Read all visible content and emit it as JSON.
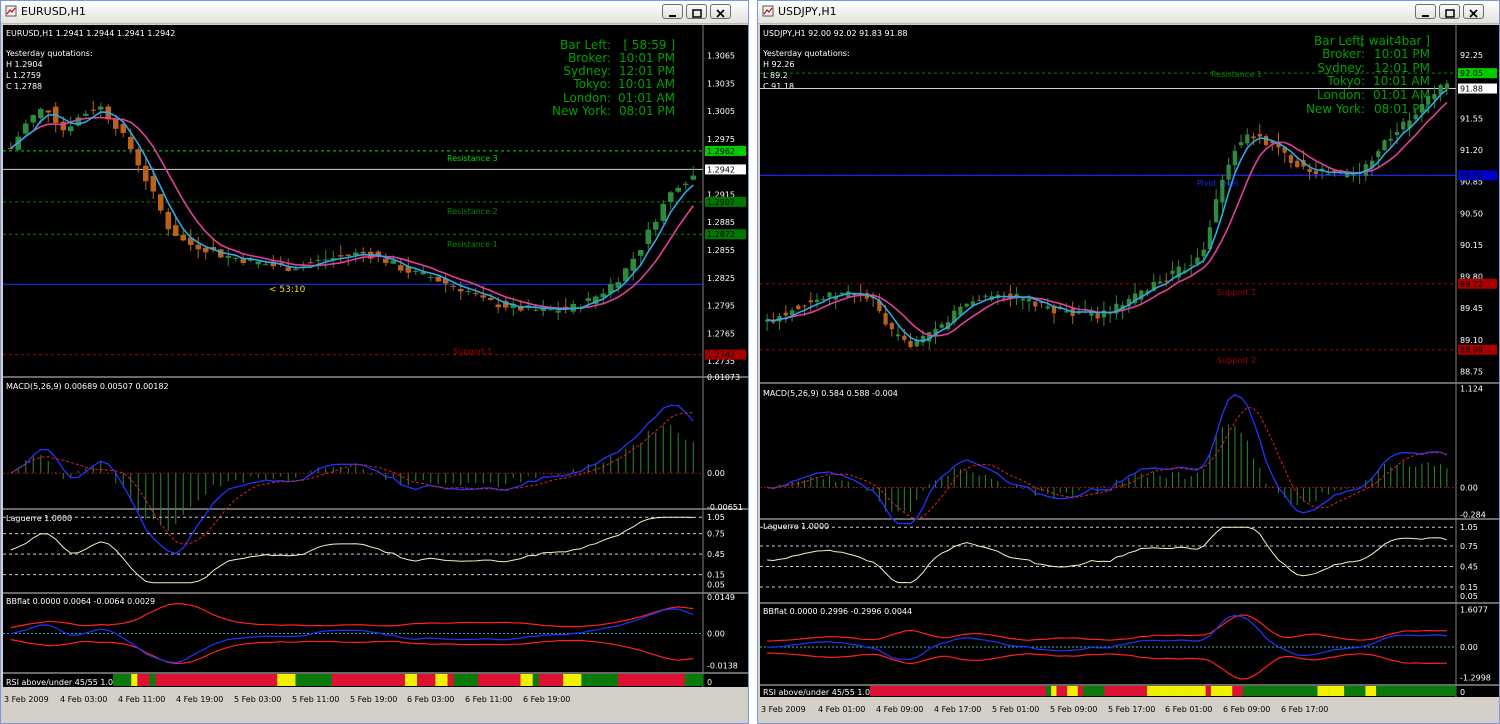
{
  "windows": [
    {
      "title": "EURUSD,H1",
      "header": "EURUSD,H1  1.2941 1.2944 1.2941 1.2942",
      "yesterday": {
        "title": "Yesterday quotations:",
        "h": "H 1.2904",
        "l": "L 1.2759",
        "c": "C 1.2788"
      },
      "info": [
        {
          "label": "Bar Left:",
          "value": "[ 58:59 ]"
        },
        {
          "label": "Broker:",
          "value": "10:01 PM"
        },
        {
          "label": "Sydney:",
          "value": "12:01 PM"
        },
        {
          "label": "Tokyo:",
          "value": "10:01 AM"
        },
        {
          "label": "London:",
          "value": "01:01 AM"
        },
        {
          "label": "New York:",
          "value": "08:01 PM"
        }
      ],
      "countdown": "< 53:10",
      "price_axis": [
        "1.3065",
        "1.3035",
        "1.3005",
        "1.2975",
        "1.2942",
        "1.2915",
        "1.2885",
        "1.2855",
        "1.2825",
        "1.2795",
        "1.2765",
        "1.2735"
      ],
      "levels": [
        {
          "label": "Resistance 3",
          "color": "#00dd00"
        },
        {
          "label": "Resistance 2",
          "color": "#008800"
        },
        {
          "label": "Resistance 1",
          "color": "#008800"
        },
        {
          "label": "Support 1",
          "color": "#aa0000"
        }
      ],
      "macd": {
        "label": "MACD(5,26,9) 0.00689 0.00507 0.00182",
        "axis": [
          "0.01073",
          "0.00",
          "-0.00651"
        ]
      },
      "laguerre": {
        "label": "Laguerre 1.0000",
        "axis": [
          "1.05",
          "0.75",
          "0.45",
          "0.15",
          "0.05"
        ]
      },
      "bbflat": {
        "label": "BBflat 0.0000 0.0064 -0.0064 0.0029",
        "axis": [
          "0.0149",
          "0.00",
          "-0.0138"
        ]
      },
      "rsi": {
        "label": "RSI above/under 45/55 1.0000"
      },
      "time_axis": [
        "3 Feb 2009",
        "4 Feb 03:00",
        "4 Feb 11:00",
        "4 Feb 19:00",
        "5 Feb 03:00",
        "5 Feb 11:00",
        "5 Feb 19:00",
        "6 Feb 03:00",
        "6 Feb 11:00",
        "6 Feb 19:00"
      ],
      "chart_data": {
        "type": "line",
        "series": [
          {
            "values": [
              1.2965,
              1.2995,
              1.301,
              1.2985,
              1.3,
              1.3012,
              1.299,
              1.296,
              1.292,
              1.288,
              1.2862,
              1.2858,
              1.285,
              1.2846,
              1.2842,
              1.2838,
              1.2836,
              1.284,
              1.2845,
              1.2848,
              1.2852,
              1.2848,
              1.2838,
              1.283,
              1.2826,
              1.2818,
              1.2812,
              1.28,
              1.2796,
              1.2792,
              1.279,
              1.279,
              1.2792,
              1.28,
              1.2812,
              1.283,
              1.2858,
              1.2895,
              1.2925,
              1.2935
            ]
          }
        ]
      }
    },
    {
      "title": "USDJPY,H1",
      "header": "USDJPY,H1  92.00 92.02 91.83 91.88",
      "yesterday": {
        "title": "Yesterday quotations:",
        "h": "H 92.26",
        "l": "L 89.2",
        "c": "C 91.18"
      },
      "info": [
        {
          "label": "Bar Left:",
          "value": "[ wait4bar ]"
        },
        {
          "label": "Broker:",
          "value": "10:01 PM"
        },
        {
          "label": "Sydney:",
          "value": "12:01 PM"
        },
        {
          "label": "Tokyo:",
          "value": "10:01 AM"
        },
        {
          "label": "London:",
          "value": "01:01 AM"
        },
        {
          "label": "New York:",
          "value": "08:01 PM"
        }
      ],
      "price_axis": [
        "92.25",
        "92.05",
        "91.88",
        "91.55",
        "91.20",
        "90.85",
        "90.50",
        "90.15",
        "89.80",
        "89.45",
        "89.10",
        "88.75"
      ],
      "levels": [
        {
          "label": "Resistance 1",
          "color": "#008800"
        },
        {
          "label": "Pivot level",
          "color": "#2222ff"
        },
        {
          "label": "Support 1",
          "color": "#aa0000"
        },
        {
          "label": "Support 2",
          "color": "#aa0000"
        }
      ],
      "macd": {
        "label": "MACD(5,26,9) 0.584 0.588 -0.004",
        "axis": [
          "1.124",
          "0.00",
          "-0.284"
        ]
      },
      "laguerre": {
        "label": "Laguerre 1.0000",
        "axis": [
          "1.05",
          "0.75",
          "0.45",
          "0.15",
          "0.05"
        ]
      },
      "bbflat": {
        "label": "BBflat 0.0000 0.2996 -0.2996 0.0044",
        "axis": [
          "1.6077",
          "0.00",
          "-1.2998"
        ]
      },
      "rsi": {
        "label": "RSI above/under 45/55 1.0000"
      },
      "time_axis": [
        "3 Feb 2009",
        "4 Feb 01:00",
        "4 Feb 09:00",
        "4 Feb 17:00",
        "5 Feb 01:00",
        "5 Feb 09:00",
        "5 Feb 17:00",
        "6 Feb 01:00",
        "6 Feb 09:00",
        "6 Feb 17:00"
      ],
      "chart_data": {
        "type": "line",
        "series": [
          {
            "values": [
              89.3,
              89.4,
              89.5,
              89.55,
              89.6,
              89.62,
              89.55,
              89.2,
              89.05,
              89.1,
              89.25,
              89.45,
              89.55,
              89.6,
              89.58,
              89.52,
              89.45,
              89.42,
              89.4,
              89.38,
              89.45,
              89.55,
              89.7,
              89.8,
              89.9,
              90.1,
              90.8,
              91.3,
              91.35,
              91.25,
              91.1,
              91.0,
              90.95,
              90.92,
              90.95,
              91.2,
              91.4,
              91.55,
              91.8,
              91.95
            ]
          }
        ]
      }
    }
  ]
}
